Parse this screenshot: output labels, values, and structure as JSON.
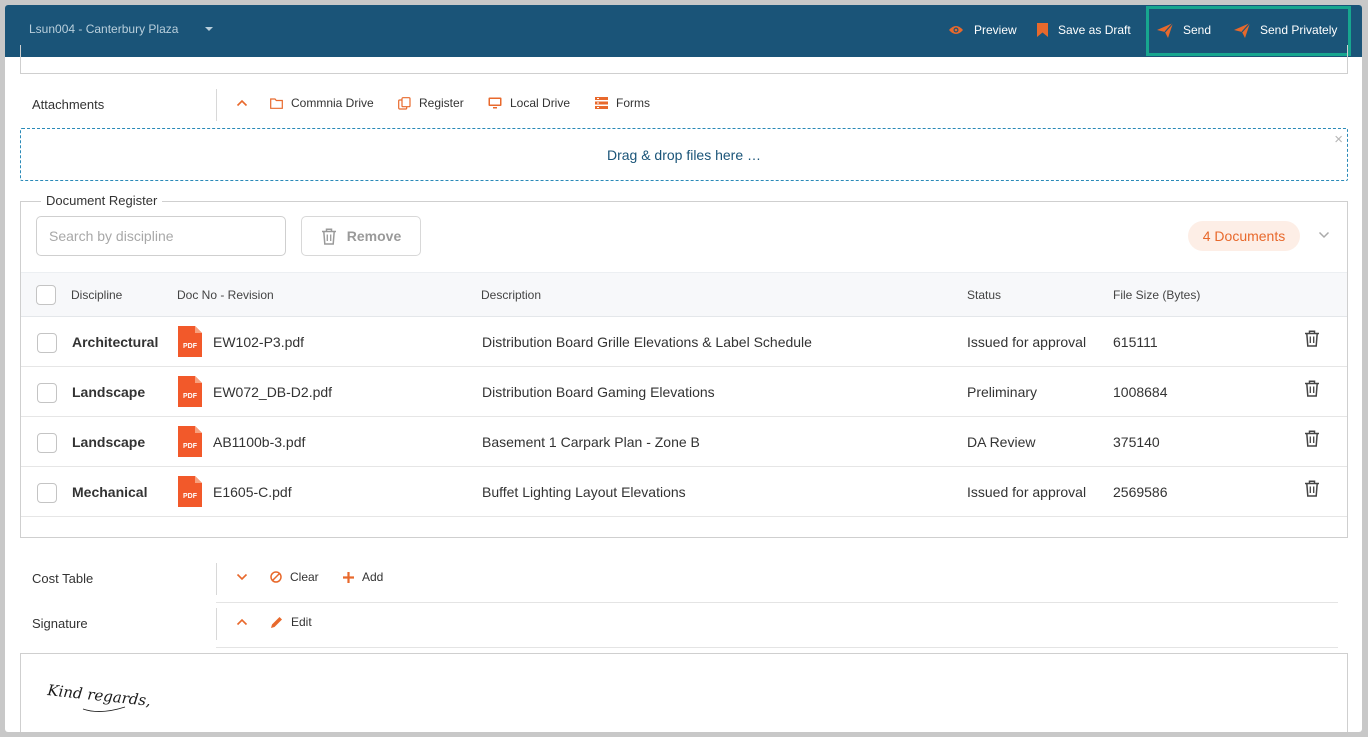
{
  "header": {
    "project": "Lsun004 - Canterbury Plaza",
    "preview": "Preview",
    "save_draft": "Save as Draft",
    "send": "Send",
    "send_privately": "Send Privately"
  },
  "attachments": {
    "label": "Attachments",
    "actions": [
      "Commnia Drive",
      "Register",
      "Local Drive",
      "Forms"
    ],
    "dropzone_text": "Drag & drop files here …",
    "dropzone_close": "×"
  },
  "document_register": {
    "title": "Document Register",
    "search_placeholder": "Search by discipline",
    "remove_label": "Remove",
    "doc_count": "4 Documents",
    "columns": [
      "Discipline",
      "Doc No - Revision",
      "Description",
      "Status",
      "File Size (Bytes)"
    ],
    "rows": [
      {
        "discipline": "Architectural",
        "doc": "EW102-P3.pdf",
        "description": "Distribution Board Grille Elevations & Label Schedule",
        "status": "Issued for approval",
        "size": "615111"
      },
      {
        "discipline": "Landscape",
        "doc": "EW072_DB-D2.pdf",
        "description": "Distribution Board Gaming Elevations",
        "status": "Preliminary",
        "size": "1008684"
      },
      {
        "discipline": "Landscape",
        "doc": "AB1100b-3.pdf",
        "description": "Basement 1 Carpark Plan - Zone B",
        "status": "DA Review",
        "size": "375140"
      },
      {
        "discipline": "Mechanical",
        "doc": "E1605-C.pdf",
        "description": "Buffet Lighting Layout Elevations",
        "status": "Issued for approval",
        "size": "2569586"
      }
    ],
    "pdf_icon_text": "PDF"
  },
  "cost_table": {
    "label": "Cost Table",
    "clear": "Clear",
    "add": "Add"
  },
  "signature": {
    "label": "Signature",
    "edit": "Edit",
    "text": "Kind regards,"
  },
  "colors": {
    "header_bg": "#1a5478",
    "accent": "#e8692c",
    "highlight": "#17a68f"
  }
}
